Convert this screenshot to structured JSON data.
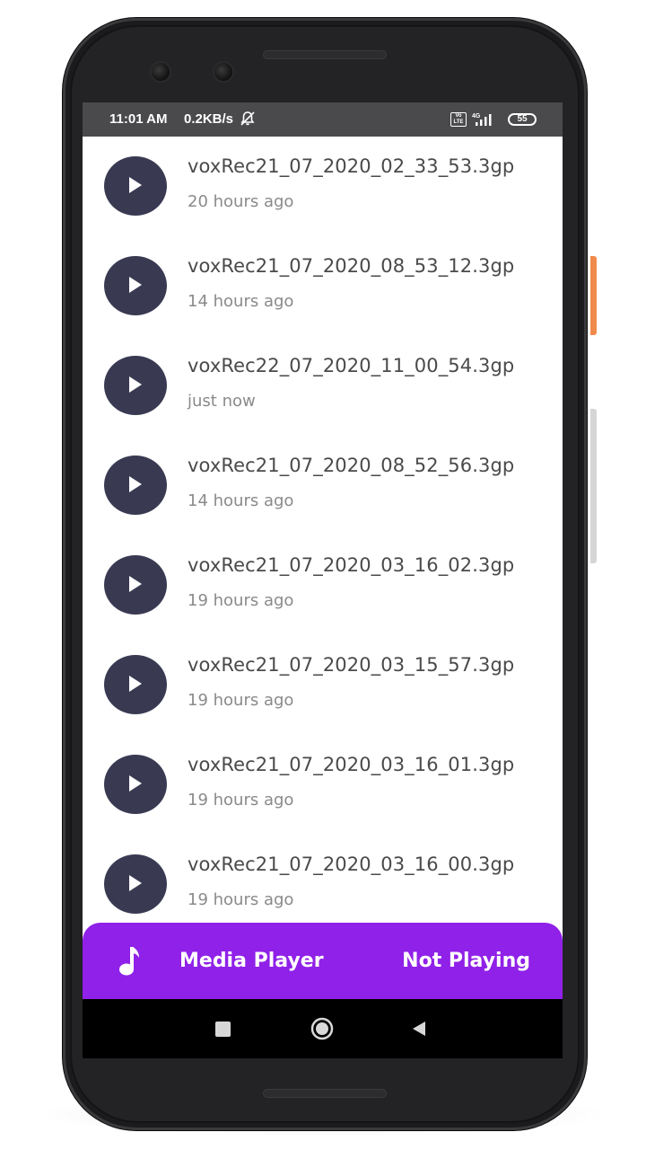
{
  "status_bar": {
    "time": "11:01 AM",
    "speed": "0.2KB/s",
    "network": "4G",
    "volte_label": "Vo LTE",
    "battery": "55",
    "icons": [
      "notifications-off-icon",
      "volte-icon",
      "signal-icon",
      "battery-icon"
    ]
  },
  "recordings": [
    {
      "title": "voxRec21_07_2020_02_33_53.3gp",
      "time": "20 hours ago"
    },
    {
      "title": "voxRec21_07_2020_08_53_12.3gp",
      "time": "14 hours ago"
    },
    {
      "title": "voxRec22_07_2020_11_00_54.3gp",
      "time": "just now"
    },
    {
      "title": "voxRec21_07_2020_08_52_56.3gp",
      "time": "14 hours ago"
    },
    {
      "title": "voxRec21_07_2020_03_16_02.3gp",
      "time": "19 hours ago"
    },
    {
      "title": "voxRec21_07_2020_03_15_57.3gp",
      "time": "19 hours ago"
    },
    {
      "title": "voxRec21_07_2020_03_16_01.3gp",
      "time": "19 hours ago"
    },
    {
      "title": "voxRec21_07_2020_03_16_00.3gp",
      "time": "19 hours ago"
    }
  ],
  "player": {
    "label": "Media Player",
    "status": "Not Playing",
    "icon": "music-note-icon"
  },
  "nav": {
    "icons": [
      "recents-square-icon",
      "home-circle-icon",
      "back-triangle-icon"
    ]
  },
  "colors": {
    "play_button": "#393a52",
    "player_bar": "#9021e8",
    "status_bar": "#4a4a4c",
    "nav_bar": "#000000"
  }
}
